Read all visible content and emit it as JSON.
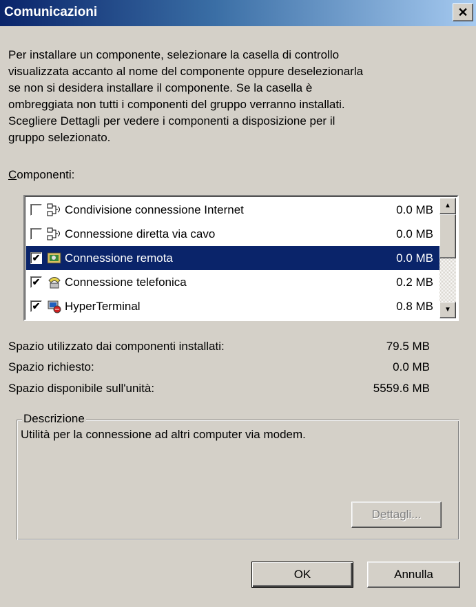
{
  "window": {
    "title": "Comunicazioni"
  },
  "intro": {
    "line1": "Per installare un componente, selezionare la casella di controllo",
    "line2": "visualizzata accanto al nome del componente oppure deselezionarla",
    "line3": "se non si desidera installare il componente. Se la casella è",
    "line4": "ombreggiata non tutti i componenti del gruppo verranno installati.",
    "line5": "Scegliere Dettagli per vedere i componenti a disposizione per il",
    "line6": "gruppo selezionato."
  },
  "components": {
    "label_accel": "C",
    "label_rest": "omponenti:",
    "items": [
      {
        "label": "Condivisione connessione Internet",
        "size": "0.0 MB",
        "checked": false,
        "icon": "network-icon"
      },
      {
        "label": "Connessione diretta via cavo",
        "size": "0.0 MB",
        "checked": false,
        "icon": "network-icon"
      },
      {
        "label": "Connessione remota",
        "size": "0.0 MB",
        "checked": true,
        "icon": "dialup-icon"
      },
      {
        "label": "Connessione telefonica",
        "size": "0.2 MB",
        "checked": true,
        "icon": "phone-icon"
      },
      {
        "label": "HyperTerminal",
        "size": "0.8 MB",
        "checked": true,
        "icon": "hyperterminal-icon"
      }
    ],
    "selected_index": 2
  },
  "space": {
    "installed_label": "Spazio utilizzato dai componenti installati:",
    "installed_value": "79.5 MB",
    "required_label": "Spazio richiesto:",
    "required_value": "0.0 MB",
    "available_label": "Spazio disponibile sull'unità:",
    "available_value": "5559.6 MB"
  },
  "description": {
    "legend": "Descrizione",
    "text": "Utilità per la connessione ad altri computer via modem."
  },
  "buttons": {
    "details_pre": "D",
    "details_accel": "e",
    "details_post": "ttagli...",
    "ok": "OK",
    "cancel": "Annulla"
  }
}
